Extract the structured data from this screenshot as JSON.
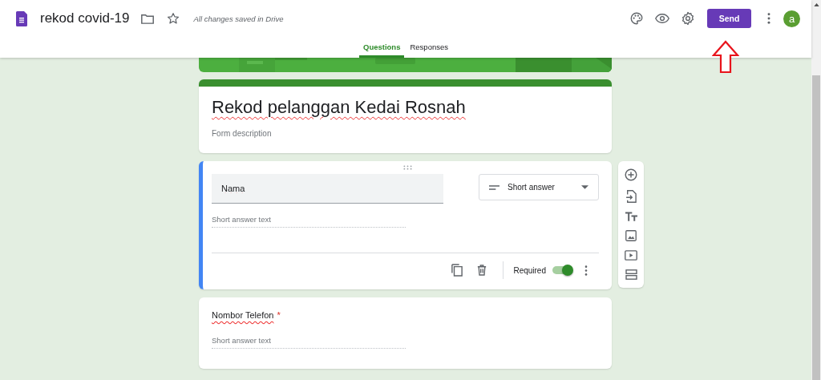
{
  "header": {
    "doc_title": "rekod covid-19",
    "saved_status": "All changes saved in Drive",
    "send_button": "Send",
    "avatar_letter": "a"
  },
  "tabs": [
    {
      "label": "Questions",
      "selected": true
    },
    {
      "label": "Responses",
      "selected": false
    }
  ],
  "form": {
    "title": "Rekod pelanggan Kedai Rosnah",
    "description_placeholder": "Form description"
  },
  "questions": [
    {
      "title": "Nama",
      "type_label": "Short answer",
      "answer_placeholder": "Short answer text",
      "required": true,
      "required_label": "Required",
      "selected": true
    },
    {
      "title": "Nombor Telefon",
      "answer_placeholder": "Short answer text",
      "required": true,
      "selected": false
    }
  ],
  "required_mark": "*"
}
